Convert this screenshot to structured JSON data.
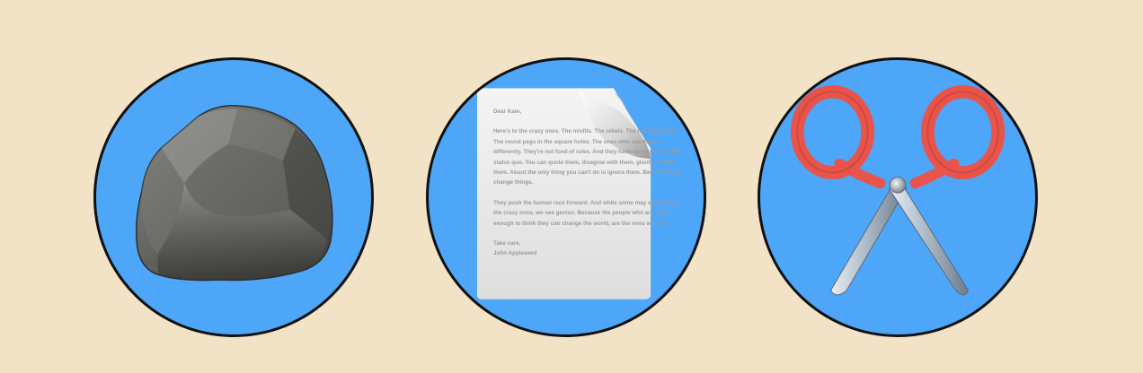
{
  "choices": [
    {
      "id": "rock",
      "icon": "rock-icon"
    },
    {
      "id": "paper",
      "icon": "paper-icon"
    },
    {
      "id": "scissors",
      "icon": "scissors-icon"
    }
  ],
  "paper_letter": {
    "greeting": "Dear Kate,",
    "paragraph1": "Here's to the crazy ones. The misfits. The rebels. The troublemakers. The round pegs in the square holes. The ones who see things differently. They're not fond of rules. And they have no respect for the status quo. You can quote them, disagree with them, glorify or vilify them. About the only thing you can't do is ignore them. Because they change things.",
    "paragraph2": "They push the human race forward. And while some may see them as the crazy ones, we see genius. Because the people who are crazy enough to think they can change the world, are the ones who do.",
    "closing": "Take care,",
    "signature": "John Appleseed"
  },
  "colors": {
    "background": "#f2e2c6",
    "button_fill": "#4da6f7",
    "button_border": "#111111",
    "scissor_handle": "#e8544a"
  }
}
